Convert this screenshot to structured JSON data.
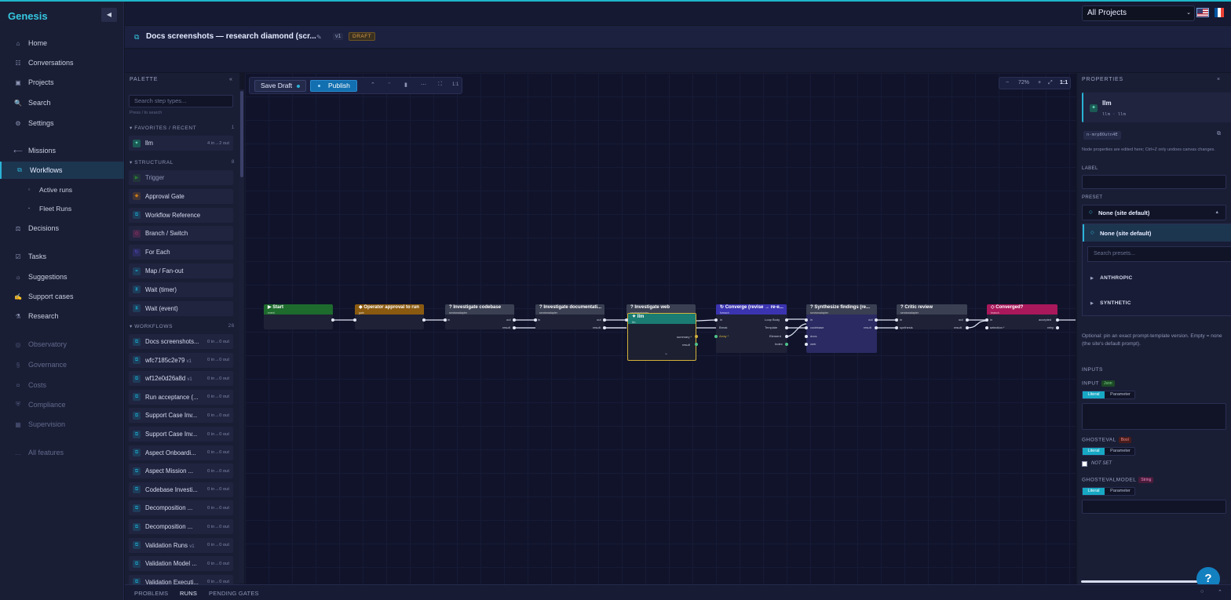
{
  "app": {
    "brand": "Genesis",
    "project_select": "All Projects"
  },
  "sidebar": {
    "items": [
      {
        "label": "Home",
        "icon": "⌂"
      },
      {
        "label": "Conversations",
        "icon": "☷"
      },
      {
        "label": "Projects",
        "icon": "▣"
      },
      {
        "label": "Search",
        "icon": "🔍"
      },
      {
        "label": "Settings",
        "icon": "⚙"
      },
      {
        "label": "Missions",
        "icon": "⟵"
      },
      {
        "label": "Workflows",
        "icon": "⧉"
      },
      {
        "label": "Active runs",
        "icon": "○"
      },
      {
        "label": "Fleet Runs",
        "icon": "▪"
      },
      {
        "label": "Decisions",
        "icon": "⚖"
      },
      {
        "label": "Tasks",
        "icon": "☑"
      },
      {
        "label": "Suggestions",
        "icon": "☼"
      },
      {
        "label": "Support cases",
        "icon": "✍"
      },
      {
        "label": "Research",
        "icon": "⚗"
      },
      {
        "label": "Observatory",
        "icon": "◎"
      },
      {
        "label": "Governance",
        "icon": "§"
      },
      {
        "label": "Costs",
        "icon": "¤"
      },
      {
        "label": "Compliance",
        "icon": "⛨"
      },
      {
        "label": "Supervision",
        "icon": "▦"
      },
      {
        "label": "All features",
        "icon": "…"
      }
    ]
  },
  "header": {
    "title": "Docs screenshots — research diamond (scr...",
    "version": "v1",
    "status": "DRAFT"
  },
  "palette": {
    "title": "PALETTE",
    "search_placeholder": "Search step types...",
    "search_hint": "Press / to search",
    "favorites": {
      "title": "FAVORITES / RECENT",
      "count": "1",
      "items": [
        {
          "label": "llm",
          "meta": "4 in→2 out"
        }
      ]
    },
    "structural": {
      "title": "STRUCTURAL",
      "count": "8",
      "items": [
        {
          "label": "Trigger",
          "icon": "▶",
          "color": "#2e7d32"
        },
        {
          "label": "Approval Gate",
          "icon": "◆",
          "color": "#c77a18"
        },
        {
          "label": "Workflow Reference",
          "icon": "⧉",
          "color": "#1aa3c7"
        },
        {
          "label": "Branch / Switch",
          "icon": "◇",
          "color": "#d03a7c"
        },
        {
          "label": "For Each",
          "icon": "↻",
          "color": "#5b4fd6"
        },
        {
          "label": "Map / Fan-out",
          "icon": "⚭",
          "color": "#1aa3c7"
        },
        {
          "label": "Wait (timer)",
          "icon": "⧗",
          "color": "#1aa3c7"
        },
        {
          "label": "Wait (event)",
          "icon": "⧗",
          "color": "#1aa3c7"
        }
      ]
    },
    "workflows": {
      "title": "WORKFLOWS",
      "count": "26",
      "items": [
        {
          "label": "Docs screenshots...",
          "meta": "0 in→0 out"
        },
        {
          "label": "wfc7185c2e79",
          "ver": "v1",
          "meta": "0 in→0 out"
        },
        {
          "label": "wf12e0d26a8d",
          "ver": "v1",
          "meta": "0 in→0 out"
        },
        {
          "label": "Run acceptance (...",
          "meta": "0 in→0 out"
        },
        {
          "label": "Support Case Inv...",
          "meta": "0 in→0 out"
        },
        {
          "label": "Support Case Inv...",
          "meta": "0 in→0 out"
        },
        {
          "label": "Aspect Onboardi...",
          "meta": "0 in→0 out"
        },
        {
          "label": "Aspect Mission ...",
          "meta": "0 in→0 out"
        },
        {
          "label": "Codebase Investi...",
          "meta": "0 in→0 out"
        },
        {
          "label": "Decomposition ...",
          "meta": "0 in→0 out"
        },
        {
          "label": "Decomposition ...",
          "meta": "0 in→0 out"
        },
        {
          "label": "Validation Runs",
          "ver": "v1",
          "meta": "0 in→0 out"
        },
        {
          "label": "Validation Model ...",
          "meta": "0 in→0 out"
        },
        {
          "label": "Validation Executi...",
          "meta": "0 in→0 out"
        }
      ]
    }
  },
  "canvas": {
    "save_label": "Save Draft",
    "publish_label": "Publish",
    "zoom": "72%",
    "ratio": "1:1",
    "nodes": [
      {
        "title": "Start",
        "sub": "event",
        "color": "#1e6b2e",
        "icon": "▶"
      },
      {
        "title": "Operator approval to run",
        "sub": "gate",
        "color": "#8a5a10",
        "icon": "◆"
      },
      {
        "title": "Investigate codebase",
        "sub": "serviceadapter",
        "color": "#3a3f52",
        "icon": "?"
      },
      {
        "title": "Investigate documentati...",
        "sub": "serviceadapter",
        "color": "#3a3f52",
        "icon": "?"
      },
      {
        "title": "Investigate web",
        "sub": "serviceadapter",
        "color": "#3a3f52",
        "icon": "?"
      },
      {
        "title": "Converge (revise → re-e...",
        "sub": "foreach",
        "color": "#3b34b0",
        "icon": "↻"
      },
      {
        "title": "Synthesize findings (re...",
        "sub": "serviceadapter",
        "color": "#3a3f52",
        "icon": "?"
      },
      {
        "title": "Critic review",
        "sub": "serviceadapter",
        "color": "#3a3f52",
        "icon": "?"
      },
      {
        "title": "Converged?",
        "sub": "branch",
        "color": "#a8185a",
        "icon": "◇"
      }
    ],
    "llm_node": {
      "title": "llm",
      "sub": "llm",
      "ports": [
        "summary *",
        "result"
      ]
    },
    "port_labels": {
      "in": "in",
      "out": "out",
      "result": "result",
      "loop_body": "Loop Body",
      "break": "Break",
      "template": "Template",
      "element": "Element",
      "index": "Index",
      "array": "Array *",
      "codebase": "codebase",
      "docs": "docs",
      "web": "web",
      "synthesis": "synthesis",
      "selection": "selection *",
      "accepted": "accepted",
      "retry": "retry"
    }
  },
  "properties": {
    "title": "PROPERTIES",
    "node_name": "llm",
    "node_sub": "llm · llm",
    "node_id": "n-mrp8Outn4E",
    "note": "Node properties are edited here; Ctrl+Z only undoes canvas changes.",
    "label_title": "LABEL",
    "preset_title": "PRESET",
    "preset_value": "None (site default)",
    "dropdown": {
      "selected": "None (site default)",
      "search_placeholder": "Search presets...",
      "groups": [
        "ANTHROPIC",
        "SYNTHETIC"
      ]
    },
    "preset_help": "Optional: pin an exact prompt-template version. Empty = none (the site's default prompt).",
    "inputs_title": "INPUTS",
    "fields": [
      {
        "name": "INPUT",
        "type": "Json",
        "type_color": "#2e7d32"
      },
      {
        "name": "GHOSTEVAL",
        "type": "Bool",
        "type_color": "#b23a3a"
      },
      {
        "name": "GHOSTEVALMODEL",
        "type": "String",
        "type_color": "#b8337a"
      }
    ],
    "seg_literal": "Literal",
    "seg_parameter": "Parameter",
    "not_set": "NOT SET"
  },
  "bottom": {
    "tabs": [
      "PROBLEMS",
      "RUNS",
      "PENDING GATES"
    ]
  }
}
